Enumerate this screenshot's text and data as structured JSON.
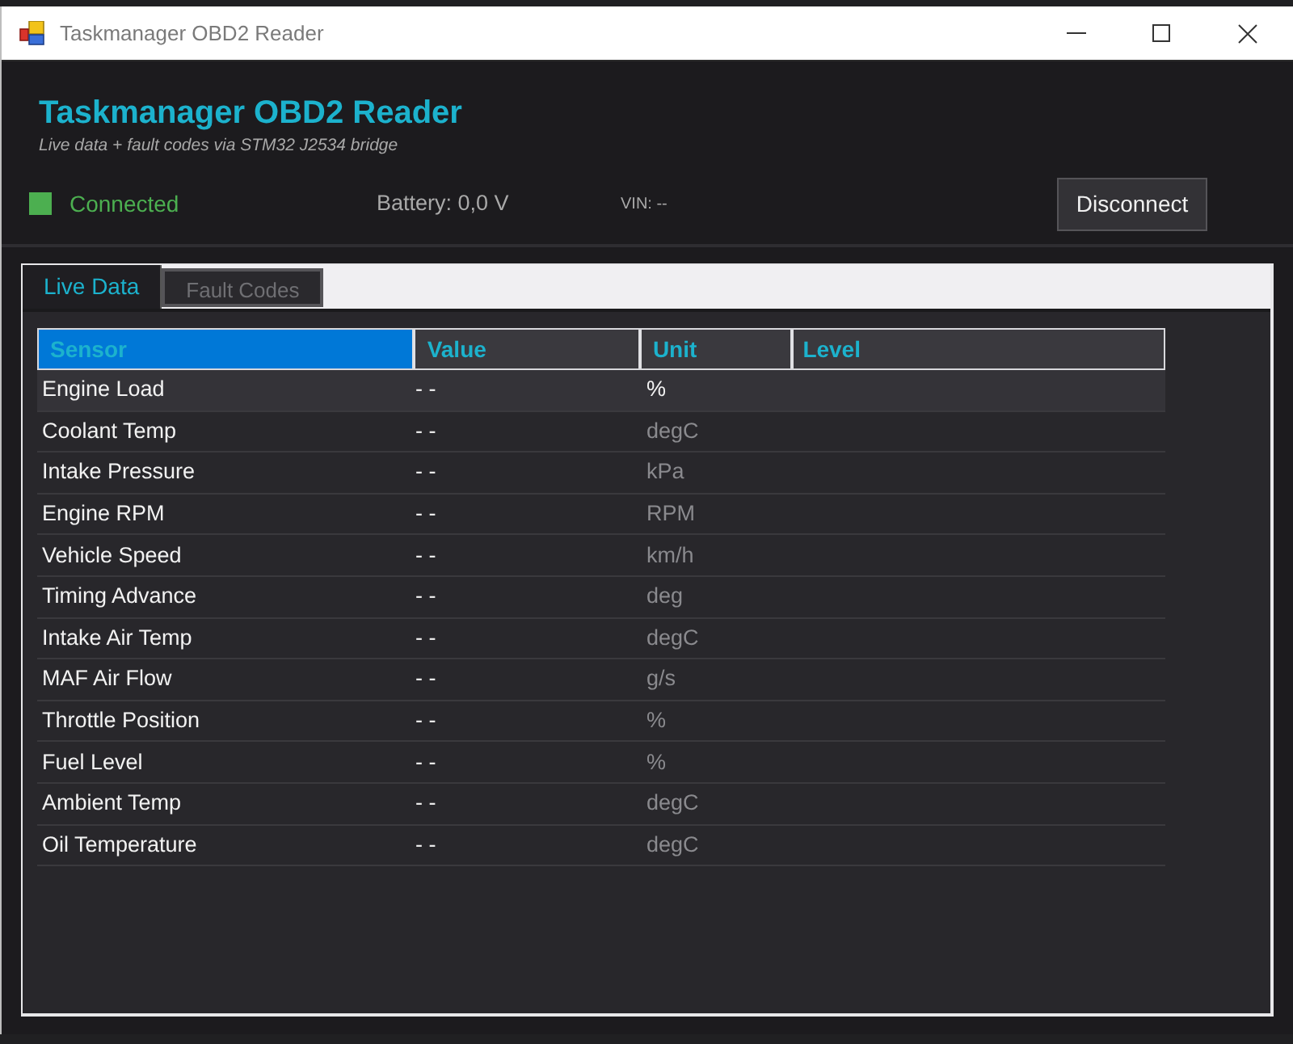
{
  "window": {
    "title": "Taskmanager OBD2 Reader"
  },
  "header": {
    "title": "Taskmanager OBD2 Reader",
    "subtitle": "Live data + fault codes via STM32 J2534 bridge"
  },
  "status": {
    "connected": true,
    "connection_label": "Connected",
    "battery": "Battery: 0,0 V",
    "vin": "VIN: --",
    "button": "Disconnect"
  },
  "tabs": [
    {
      "label": "Live Data",
      "selected": true
    },
    {
      "label": "Fault Codes",
      "selected": false
    }
  ],
  "table": {
    "columns": [
      {
        "label": "Sensor",
        "selected": true
      },
      {
        "label": "Value",
        "selected": false
      },
      {
        "label": "Unit",
        "selected": false
      },
      {
        "label": "Level",
        "selected": false
      }
    ],
    "rows": [
      {
        "sensor": "Engine Load",
        "value": "- -",
        "unit": "%",
        "selected": true
      },
      {
        "sensor": "Coolant Temp",
        "value": "- -",
        "unit": "degC",
        "selected": false
      },
      {
        "sensor": "Intake Pressure",
        "value": "- -",
        "unit": "kPa",
        "selected": false
      },
      {
        "sensor": "Engine RPM",
        "value": "- -",
        "unit": "RPM",
        "selected": false
      },
      {
        "sensor": "Vehicle Speed",
        "value": "- -",
        "unit": "km/h",
        "selected": false
      },
      {
        "sensor": "Timing Advance",
        "value": "- -",
        "unit": "deg",
        "selected": false
      },
      {
        "sensor": "Intake Air Temp",
        "value": "- -",
        "unit": "degC",
        "selected": false
      },
      {
        "sensor": "MAF Air Flow",
        "value": "- -",
        "unit": "g/s",
        "selected": false
      },
      {
        "sensor": "Throttle Position",
        "value": "- -",
        "unit": "%",
        "selected": false
      },
      {
        "sensor": "Fuel Level",
        "value": "- -",
        "unit": "%",
        "selected": false
      },
      {
        "sensor": "Ambient Temp",
        "value": "- -",
        "unit": "degC",
        "selected": false
      },
      {
        "sensor": "Oil Temperature",
        "value": "- -",
        "unit": "degC",
        "selected": false
      }
    ]
  }
}
